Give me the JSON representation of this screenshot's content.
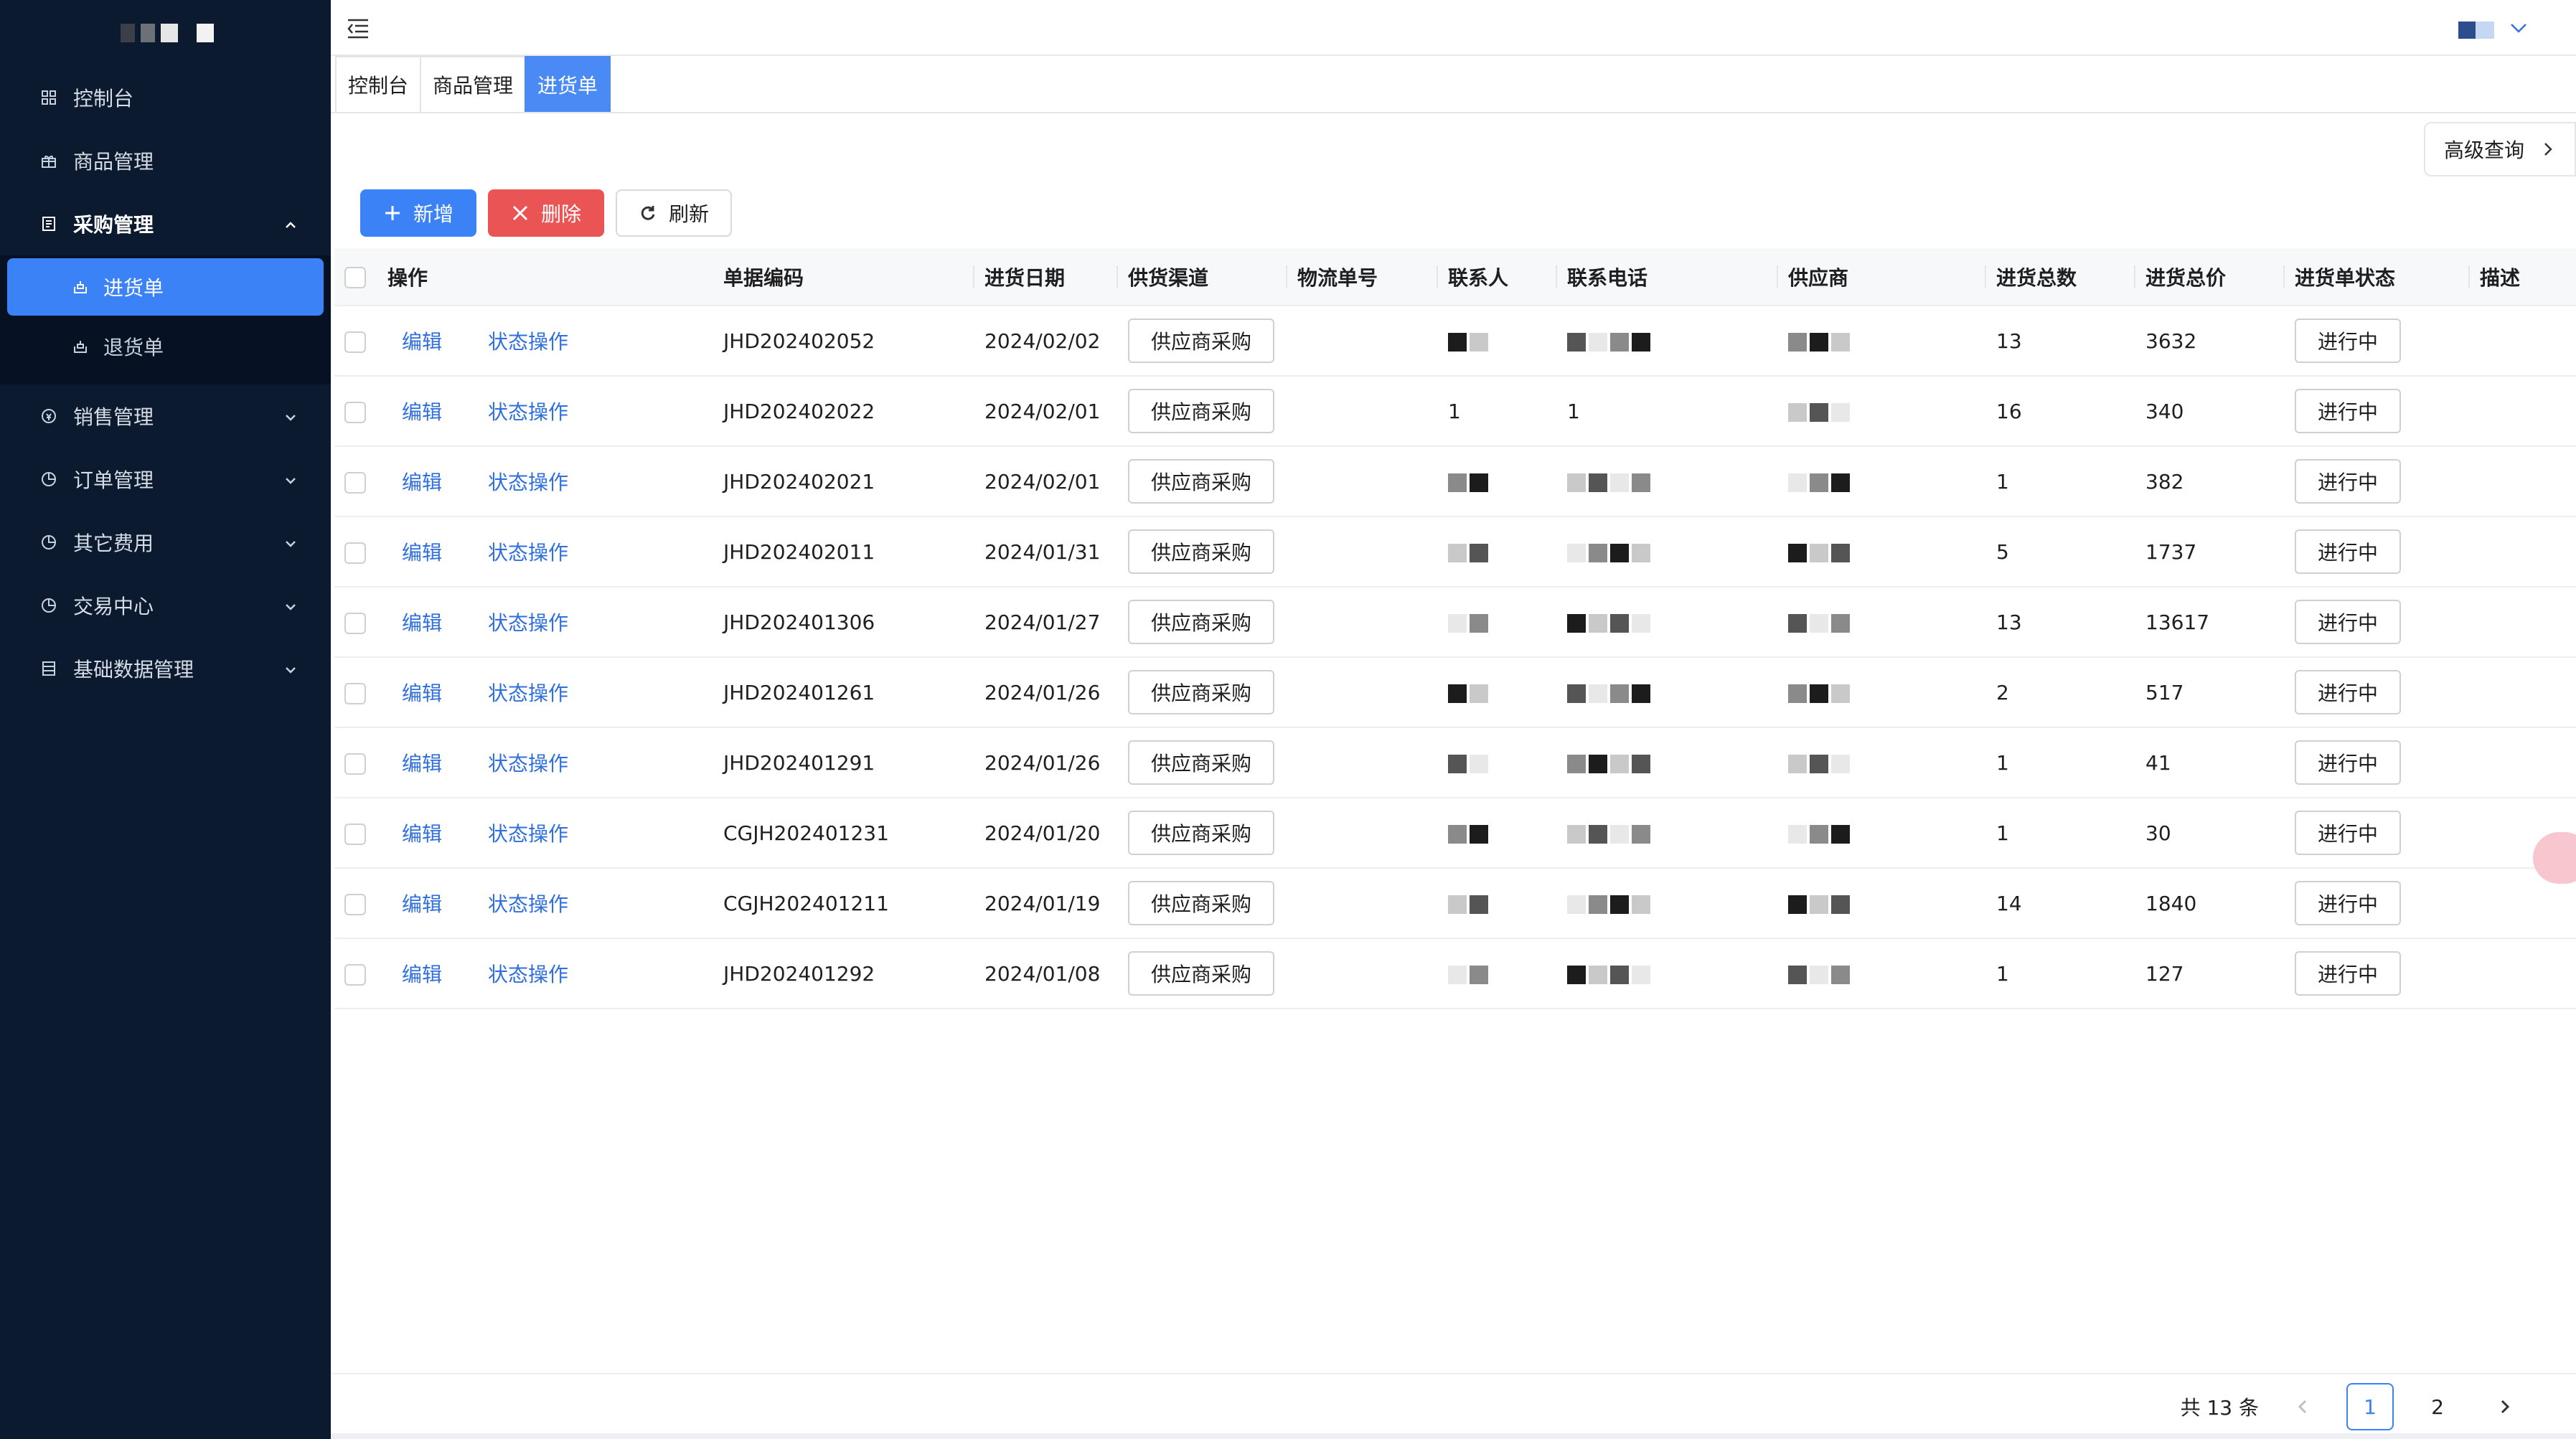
{
  "sidebar": {
    "menu": [
      {
        "label": "控制台",
        "icon": "dashboard-icon"
      },
      {
        "label": "商品管理",
        "icon": "gift-icon"
      },
      {
        "label": "采购管理",
        "icon": "document-icon",
        "open": true
      },
      {
        "label": "销售管理",
        "icon": "sales-icon"
      },
      {
        "label": "订单管理",
        "icon": "order-icon"
      },
      {
        "label": "其它费用",
        "icon": "fee-icon"
      },
      {
        "label": "交易中心",
        "icon": "trade-icon"
      },
      {
        "label": "基础数据管理",
        "icon": "database-icon"
      }
    ],
    "submenu": [
      {
        "label": "进货单",
        "active": true
      },
      {
        "label": "退货单",
        "active": false
      }
    ]
  },
  "tabs": [
    "控制台",
    "商品管理",
    "进货单"
  ],
  "toolbar": {
    "add": "新增",
    "delete": "删除",
    "refresh": "刷新"
  },
  "advanced_query": "高级查询",
  "table": {
    "headers": [
      "操作",
      "单据编码",
      "进货日期",
      "供货渠道",
      "物流单号",
      "联系人",
      "联系电话",
      "供应商",
      "进货总数",
      "进货总价",
      "进货单状态",
      "描述"
    ],
    "edit_label": "编辑",
    "status_op_label": "状态操作",
    "rows": [
      {
        "code": "JHD202402052",
        "date": "2024/02/02",
        "channel": "供应商采购",
        "logistics": "",
        "contact": "",
        "phone": "",
        "total": "13",
        "price": "3632",
        "status": "进行中"
      },
      {
        "code": "JHD202402022",
        "date": "2024/02/01",
        "channel": "供应商采购",
        "logistics": "",
        "contact": "1",
        "phone": "1",
        "total": "16",
        "price": "340",
        "status": "进行中"
      },
      {
        "code": "JHD202402021",
        "date": "2024/02/01",
        "channel": "供应商采购",
        "logistics": "",
        "contact": "",
        "phone": "",
        "total": "1",
        "price": "382",
        "status": "进行中"
      },
      {
        "code": "JHD202402011",
        "date": "2024/01/31",
        "channel": "供应商采购",
        "logistics": "",
        "contact": "",
        "phone": "",
        "total": "5",
        "price": "1737",
        "status": "进行中"
      },
      {
        "code": "JHD202401306",
        "date": "2024/01/27",
        "channel": "供应商采购",
        "logistics": "",
        "contact": "",
        "phone": "",
        "total": "13",
        "price": "13617",
        "status": "进行中"
      },
      {
        "code": "JHD202401261",
        "date": "2024/01/26",
        "channel": "供应商采购",
        "logistics": "",
        "contact": "",
        "phone": "",
        "total": "2",
        "price": "517",
        "status": "进行中"
      },
      {
        "code": "JHD202401291",
        "date": "2024/01/26",
        "channel": "供应商采购",
        "logistics": "",
        "contact": "",
        "phone": "",
        "total": "1",
        "price": "41",
        "status": "进行中"
      },
      {
        "code": "CGJH202401231",
        "date": "2024/01/20",
        "channel": "供应商采购",
        "logistics": "",
        "contact": "",
        "phone": "",
        "total": "1",
        "price": "30",
        "status": "进行中"
      },
      {
        "code": "CGJH202401211",
        "date": "2024/01/19",
        "channel": "供应商采购",
        "logistics": "",
        "contact": "",
        "phone": "",
        "total": "14",
        "price": "1840",
        "status": "进行中"
      },
      {
        "code": "JHD202401292",
        "date": "2024/01/08",
        "channel": "供应商采购",
        "logistics": "",
        "contact": "",
        "phone": "",
        "total": "1",
        "price": "127",
        "status": "进行中"
      }
    ]
  },
  "pagination": {
    "total_text": "共 13 条",
    "pages": [
      "1",
      "2"
    ],
    "current": "1"
  },
  "colors": {
    "sidebar_bg": "#0b1a2e",
    "accent": "#3b82f6",
    "danger": "#ea5455",
    "link": "#2f6fe0"
  }
}
